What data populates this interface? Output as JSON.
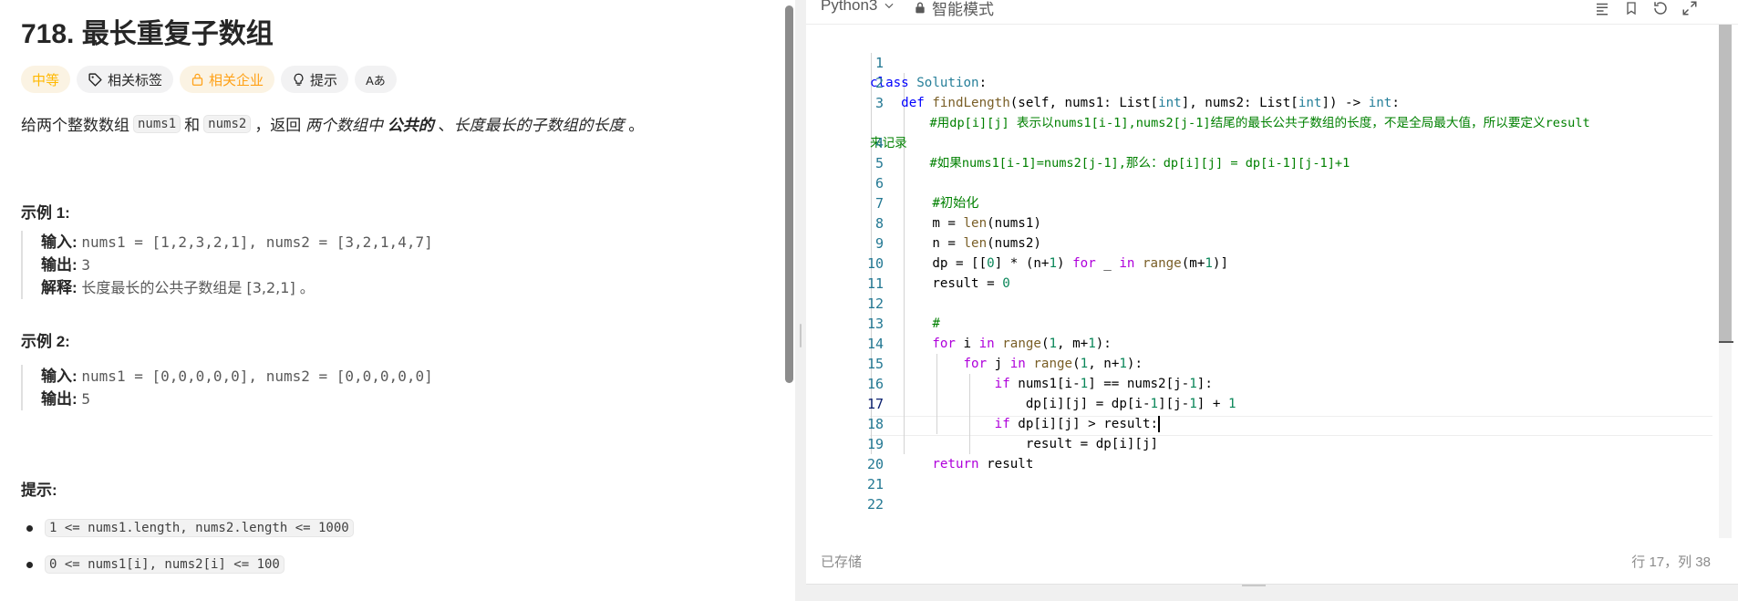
{
  "problem": {
    "title": "718. 最长重复子数组",
    "tags": {
      "difficulty": "中等",
      "related_tags": "相关标签",
      "related_companies": "相关企业",
      "hint": "提示",
      "translate": "Aあ"
    },
    "description": {
      "p1": "给两个整数数组",
      "code1": "nums1",
      "p2": "和",
      "code2": "nums2",
      "p3": "，返回",
      "em1": "两个数组中",
      "bold1": "公共的",
      "p4": "、",
      "em2": "长度最长的子数组的长度",
      "p5": "。"
    },
    "example1": {
      "heading": "示例 1:",
      "input_label": "输入:",
      "input_value": "nums1 = [1,2,3,2,1], nums2 = [3,2,1,4,7]",
      "output_label": "输出:",
      "output_value": "3",
      "explain_label": "解释:",
      "explain_value": "长度最长的公共子数组是 [3,2,1] 。"
    },
    "example2": {
      "heading": "示例 2:",
      "input_label": "输入:",
      "input_value": "nums1 = [0,0,0,0,0], nums2 = [0,0,0,0,0]",
      "output_label": "输出:",
      "output_value": "5"
    },
    "hints": {
      "heading": "提示:",
      "items": [
        "1 <= nums1.length, nums2.length <= 1000",
        "0 <= nums1[i], nums2[i] <= 100"
      ]
    }
  },
  "editor": {
    "language": "Python3",
    "mode": "智能模式",
    "line_numbers": [
      "1",
      "2",
      "3",
      "",
      "4",
      "5",
      "6",
      "7",
      "8",
      "9",
      "10",
      "11",
      "12",
      "13",
      "14",
      "15",
      "16",
      "17",
      "18",
      "19",
      "20",
      "21",
      "22"
    ],
    "active_line": "17",
    "code": {
      "l1_kw": "class",
      "l1_cls": "Solution",
      "l1_rest": ":",
      "l2_kw": "def",
      "l2_fn": "findLength",
      "l2_a": "(self, nums1: List[",
      "l2_t1": "int",
      "l2_b": "], nums2: List[",
      "l2_t2": "int",
      "l2_c": "]) -> ",
      "l2_t3": "int",
      "l2_d": ":",
      "l3_cmt": "#用dp[i][j] 表示以nums1[i-1],nums2[j-1]结尾的最长公共子数组的长度，不是全局最大值，所以要定义result",
      "l3_cmt_wrap": "来记录",
      "l4_cmt": "#如果nums1[i-1]=nums2[j-1],那么：dp[i][j] = dp[i-1][j-1]+1",
      "l6_cmt": "#初始化",
      "l7_a": "m = ",
      "l7_fn": "len",
      "l7_b": "(nums1)",
      "l8_a": "n = ",
      "l8_fn": "len",
      "l8_b": "(nums2)",
      "l9_a": "dp = [[",
      "l9_n0": "0",
      "l9_b": "] * (n+",
      "l9_n1": "1",
      "l9_c": ") ",
      "l9_for": "for",
      "l9_d": " _ ",
      "l9_in": "in",
      "l9_e": " ",
      "l9_range": "range",
      "l9_f": "(m+",
      "l9_n2": "1",
      "l9_g": ")]",
      "l10_a": "result = ",
      "l10_n": "0",
      "l12_cmt": "#",
      "l13_for": "for",
      "l13_a": " i ",
      "l13_in": "in",
      "l13_b": " ",
      "l13_range": "range",
      "l13_c": "(",
      "l13_n1": "1",
      "l13_d": ", m+",
      "l13_n2": "1",
      "l13_e": "):",
      "l14_for": "for",
      "l14_a": " j ",
      "l14_in": "in",
      "l14_b": " ",
      "l14_range": "range",
      "l14_c": "(",
      "l14_n1": "1",
      "l14_d": ", n+",
      "l14_n2": "1",
      "l14_e": "):",
      "l15_if": "if",
      "l15_a": " nums1[i-",
      "l15_n1": "1",
      "l15_b": "] == nums2[j-",
      "l15_n2": "1",
      "l15_c": "]:",
      "l16_a": "dp[i][j] = dp[i-",
      "l16_n1": "1",
      "l16_b": "][j-",
      "l16_n2": "1",
      "l16_c": "] + ",
      "l16_n3": "1",
      "l17_if": "if",
      "l17_a": " dp[i][j] > result:",
      "l18_a": "result = dp[i][j]",
      "l19_ret": "return",
      "l19_a": " result"
    },
    "status_saved": "已存储",
    "status_position": "行 17，列 38"
  },
  "colors": {
    "medium": "#ffb800",
    "company": "#ffa116",
    "keyword": "#0000ff",
    "control": "#af00db",
    "comment": "#008000",
    "number": "#098658"
  }
}
